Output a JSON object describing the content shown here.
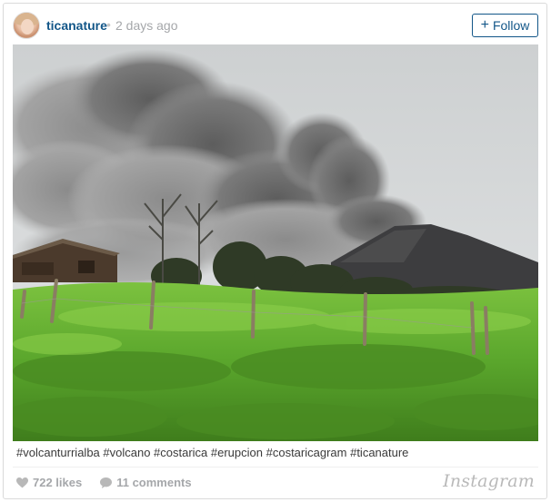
{
  "post": {
    "username": "ticanature",
    "separator": "•",
    "time_ago": "2 days ago",
    "follow_label": "Follow",
    "follow_plus": "+",
    "caption": "#volcanturrialba #volcano #costarica #erupcion #costaricagram #ticanature",
    "likes": "722 likes",
    "comments": "11 comments",
    "brand": "Instagram"
  },
  "colors": {
    "link": "#125688",
    "muted": "#a5a7aa",
    "grass": "#5aa62c",
    "smoke": "#6f6f6f"
  },
  "icons": {
    "likes": "heart-icon",
    "comments": "speech-bubble-icon"
  }
}
